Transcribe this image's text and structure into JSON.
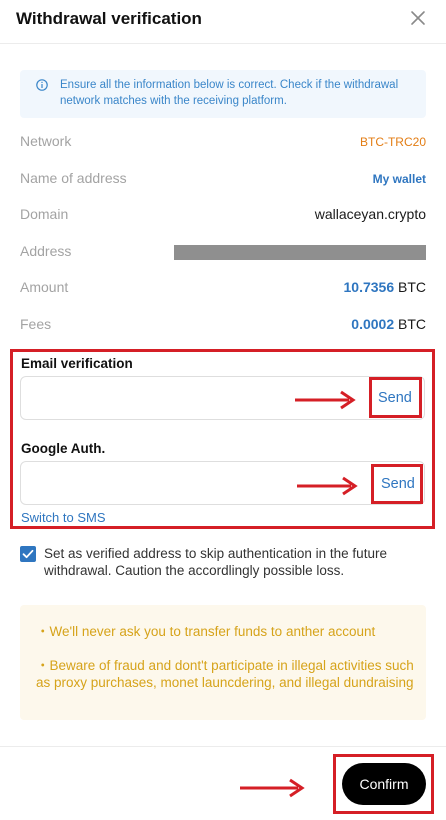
{
  "header": {
    "title": "Withdrawal verification"
  },
  "notice": {
    "text": "Ensure all the information below is correct. Check if the withdrawal network matches with the receiving platform."
  },
  "details": {
    "network": {
      "label": "Network",
      "value": "BTC-TRC20"
    },
    "name_of_address": {
      "label": "Name of address",
      "value": "My wallet"
    },
    "domain": {
      "label": "Domain",
      "value": "wallaceyan.crypto"
    },
    "address": {
      "label": "Address"
    },
    "amount": {
      "label": "Amount",
      "value": "10.7356",
      "unit": "BTC"
    },
    "fees": {
      "label": "Fees",
      "value": "0.0002",
      "unit": "BTC"
    }
  },
  "email": {
    "label": "Email verification",
    "send": "Send",
    "value": ""
  },
  "google": {
    "label": "Google Auth.",
    "send": "Send",
    "value": ""
  },
  "switch_sms": "Switch to SMS",
  "verified_checkbox": {
    "checked": true,
    "text": "Set as verified address to skip authentication in the future withdrawal. Caution the accordlingly possible loss."
  },
  "warnings": [
    "・We'll never ask you to transfer funds to anther account",
    "・Beware of fraud and dont't participate in illegal activities such as proxy purchases, monet launcdering, and illegal dundraising"
  ],
  "confirm_label": "Confirm",
  "colors": {
    "accent": "#2f76c0",
    "highlight": "#d51f26",
    "network": "#e37d14",
    "warning_text": "#d6a31a"
  }
}
